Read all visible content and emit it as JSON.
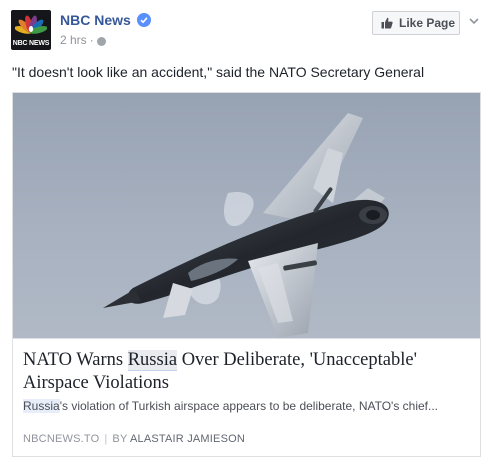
{
  "page": {
    "name": "NBC News",
    "logo_text": "NBC NEWS",
    "verified": true,
    "time": "2 hrs",
    "separator": "·",
    "privacy_icon": "globe-icon"
  },
  "like_button": {
    "label": "Like Page",
    "icon": "thumbs-up-icon"
  },
  "post": {
    "text": "\"It doesn't look like an accident,\" said the NATO Secretary General"
  },
  "link_card": {
    "image_subject": "fighter jet banking in grey-blue sky",
    "headline_before": "NATO Warns ",
    "headline_highlight": "Russia",
    "headline_after": " Over Deliberate, 'Unacceptable' Airspace Violations",
    "description_highlight": "Russia",
    "description_rest": "'s violation of Turkish airspace appears to be deliberate, NATO's chief...",
    "domain": "NBCNEWS.TO",
    "divider": "|",
    "by_label": "BY",
    "author": "ALASTAIR JAMIESON"
  },
  "colors": {
    "link_blue": "#365899",
    "verified_blue": "#5890ff",
    "meta_grey": "#90949c",
    "border": "#dddfe2"
  }
}
